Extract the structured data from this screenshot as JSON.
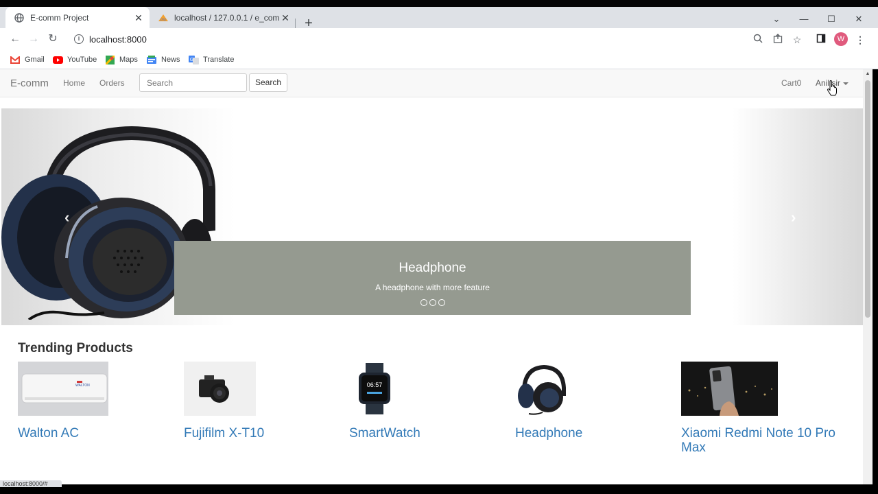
{
  "browser": {
    "tabs": [
      {
        "title": "E-comm Project",
        "active": true
      },
      {
        "title": "localhost / 127.0.0.1 / e_comm /",
        "active": false
      }
    ],
    "url": "localhost:8000",
    "profile_initial": "W",
    "bookmarks": [
      {
        "label": "Gmail",
        "icon": "gmail-icon"
      },
      {
        "label": "YouTube",
        "icon": "youtube-icon"
      },
      {
        "label": "Maps",
        "icon": "maps-icon"
      },
      {
        "label": "News",
        "icon": "news-icon"
      },
      {
        "label": "Translate",
        "icon": "translate-icon"
      }
    ],
    "status_text": "localhost:8000/#"
  },
  "navbar": {
    "brand": "E-comm",
    "links": [
      "Home",
      "Orders"
    ],
    "search_placeholder": "Search",
    "search_button": "Search",
    "cart": "Cart0",
    "user": "Anil sir"
  },
  "carousel": {
    "title": "Headphone",
    "subtitle": "A headphone with more feature",
    "slides": 3
  },
  "trending": {
    "title": "Trending Products",
    "products": [
      {
        "name": "Walton AC"
      },
      {
        "name": "Fujifilm X-T10"
      },
      {
        "name": "SmartWatch"
      },
      {
        "name": "Headphone"
      },
      {
        "name": "Xiaomi Redmi Note 10 Pro Max"
      }
    ]
  },
  "colors": {
    "link": "#337ab7",
    "caption_bg": "#959a90",
    "navbar_bg": "#f8f8f8"
  }
}
